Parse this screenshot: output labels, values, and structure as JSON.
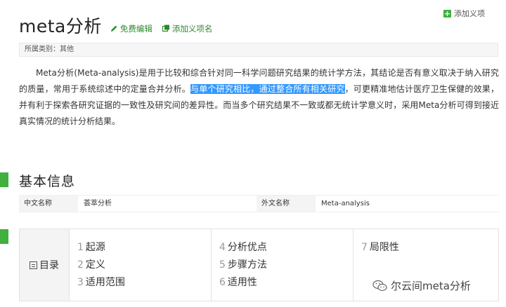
{
  "header": {
    "add_term_label": "添加义项",
    "title": "meta分析",
    "edit_label": "免费编辑",
    "add_term_name_label": "添加义项名"
  },
  "category": {
    "text": "所属类别：其他"
  },
  "summary": {
    "part1": "Meta分析(Meta-analysis)是用于比较和综合针对同一科学问题研究结果的统计学方法，其结论是否有意义取决于纳入研究的质量，常用于系统综述中的定量合并分析。",
    "highlight": "与单个研究相比，通过整合所有相关研究",
    "part2": "，可更精准地估计医疗卫生保健的效果，并有利于探索各研究证据的一致性及研究间的差异性。而当多个研究结果不一致或都无统计学意义时，采用Meta分析可得到接近真实情况的统计分析结果。"
  },
  "basic_info": {
    "title": "基本信息",
    "fields": [
      {
        "label": "中文名称",
        "value": "荟萃分析"
      },
      {
        "label": "外文名称",
        "value": "Meta-analysis"
      }
    ]
  },
  "toc": {
    "label": "目录",
    "columns": [
      [
        {
          "num": "1",
          "text": "起源"
        },
        {
          "num": "2",
          "text": "定义"
        },
        {
          "num": "3",
          "text": "适用范围"
        }
      ],
      [
        {
          "num": "4",
          "text": "分析优点"
        },
        {
          "num": "5",
          "text": "步骤方法"
        },
        {
          "num": "6",
          "text": "适用性"
        }
      ],
      [
        {
          "num": "7",
          "text": "局限性"
        }
      ]
    ]
  },
  "watermark": {
    "text": "尔云间meta分析",
    "icon": "wechat-icon"
  },
  "colors": {
    "accent_green": "#40b13e",
    "highlight_blue": "#3399ff"
  }
}
